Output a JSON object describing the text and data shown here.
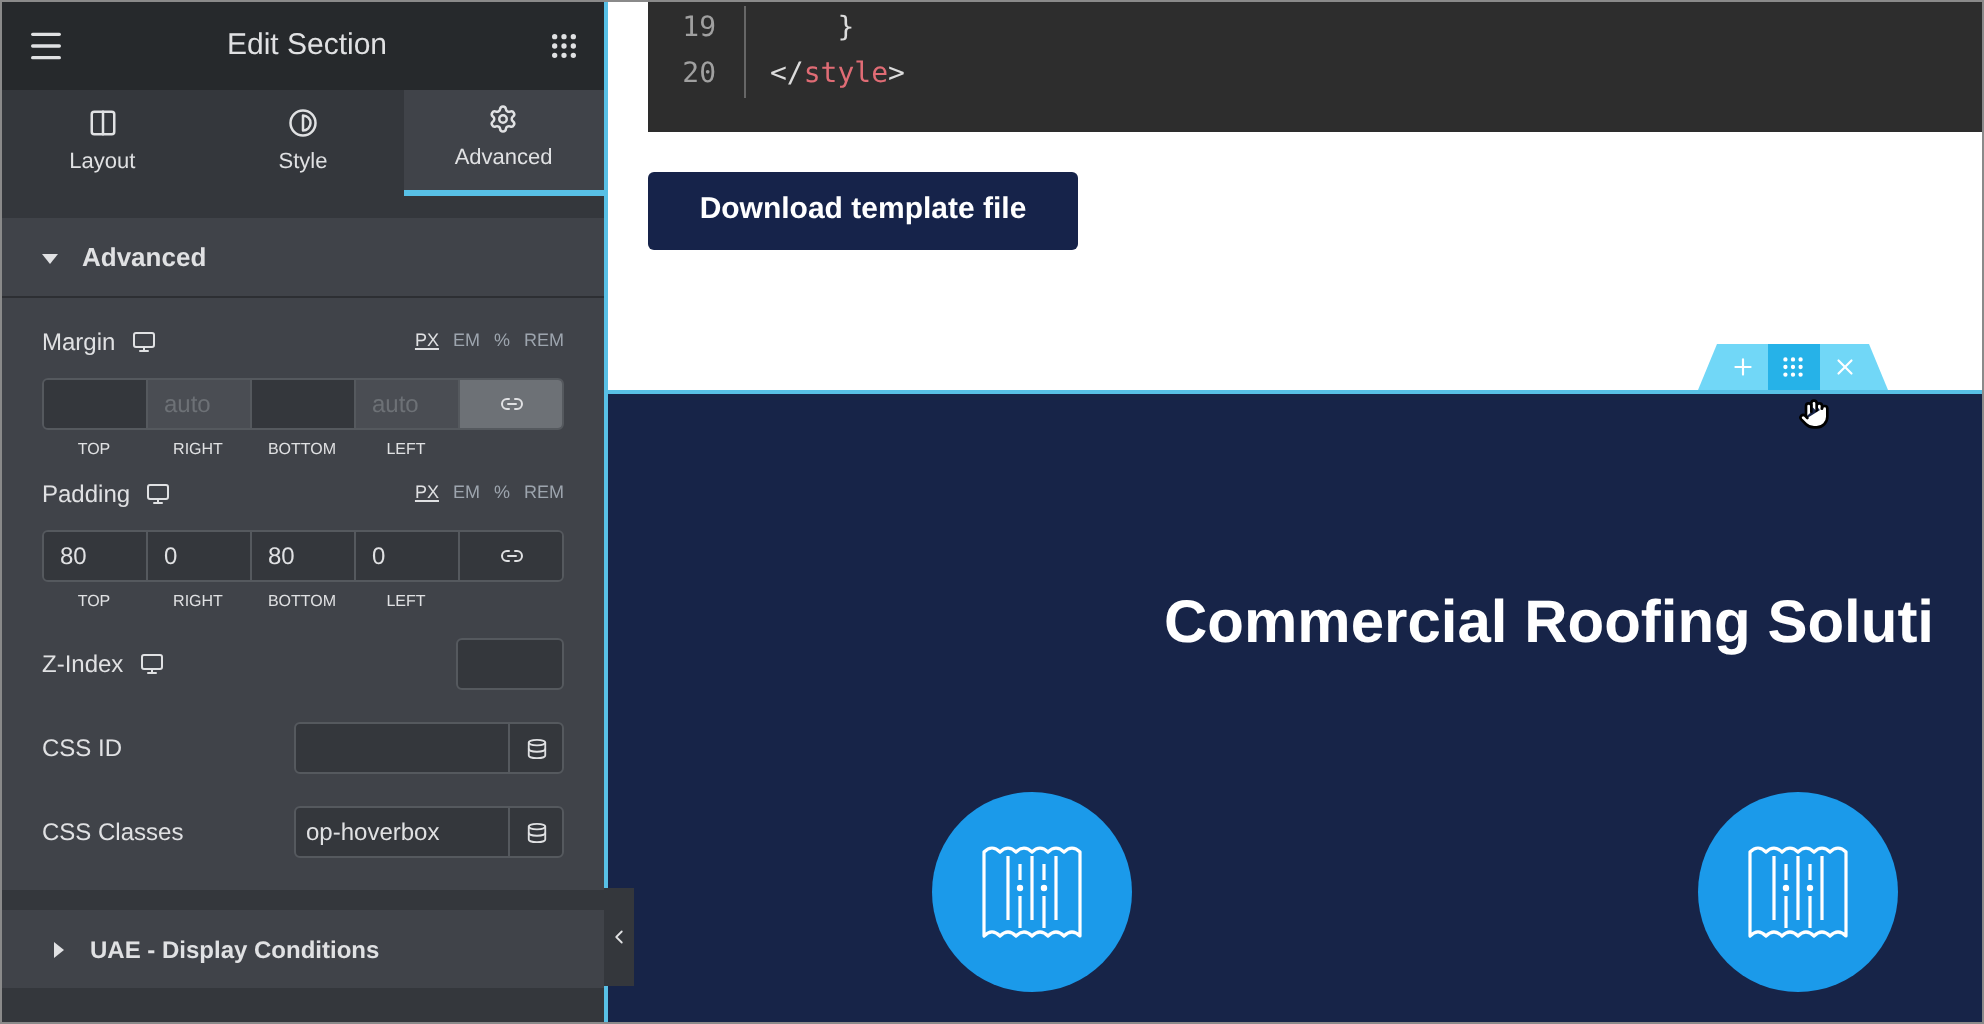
{
  "panel": {
    "title": "Edit Section"
  },
  "tabs": [
    {
      "label": "Layout",
      "kind": "layout",
      "selected": false
    },
    {
      "label": "Style",
      "kind": "style",
      "selected": false
    },
    {
      "label": "Advanced",
      "kind": "advanced",
      "selected": true
    }
  ],
  "section": {
    "title": "Advanced",
    "expanded": true
  },
  "spacing": [
    {
      "label": "Margin",
      "units": [
        {
          "label": "PX",
          "selected": true
        },
        {
          "label": "EM",
          "selected": false
        },
        {
          "label": "%",
          "selected": false
        },
        {
          "label": "REM",
          "selected": false
        }
      ],
      "linked": true,
      "fields": [
        {
          "label": "TOP",
          "disabled": false
        },
        {
          "label": "RIGHT",
          "placeholder": "auto",
          "disabled": true
        },
        {
          "label": "BOTTOM",
          "disabled": false
        },
        {
          "label": "LEFT",
          "placeholder": "auto",
          "disabled": true
        }
      ]
    },
    {
      "label": "Padding",
      "units": [
        {
          "label": "PX",
          "selected": true
        },
        {
          "label": "EM",
          "selected": false
        },
        {
          "label": "%",
          "selected": false
        },
        {
          "label": "REM",
          "selected": false
        }
      ],
      "linked": false,
      "fields": [
        {
          "label": "TOP",
          "value": "80",
          "disabled": false
        },
        {
          "label": "RIGHT",
          "value": "0",
          "disabled": false
        },
        {
          "label": "BOTTOM",
          "value": "80",
          "disabled": false
        },
        {
          "label": "LEFT",
          "value": "0",
          "disabled": false
        }
      ]
    }
  ],
  "z_index": {
    "label": "Z-Index"
  },
  "css_id": {
    "label": "CSS ID"
  },
  "css_classes": {
    "label": "CSS Classes",
    "value": "op-hoverbox"
  },
  "collapsed_section": {
    "title": "UAE - Display Conditions",
    "expanded": false
  },
  "code": [
    {
      "number": "19",
      "tokens": [
        {
          "text": "    }",
          "kind": "punct"
        }
      ]
    },
    {
      "number": "20",
      "tokens": [
        {
          "text": "</",
          "kind": "punct"
        },
        {
          "text": "style",
          "kind": "tag"
        },
        {
          "text": ">",
          "kind": "punct"
        }
      ]
    }
  ],
  "download_button": "Download template file",
  "hero": {
    "heading": "Commercial Roofing Soluti"
  }
}
